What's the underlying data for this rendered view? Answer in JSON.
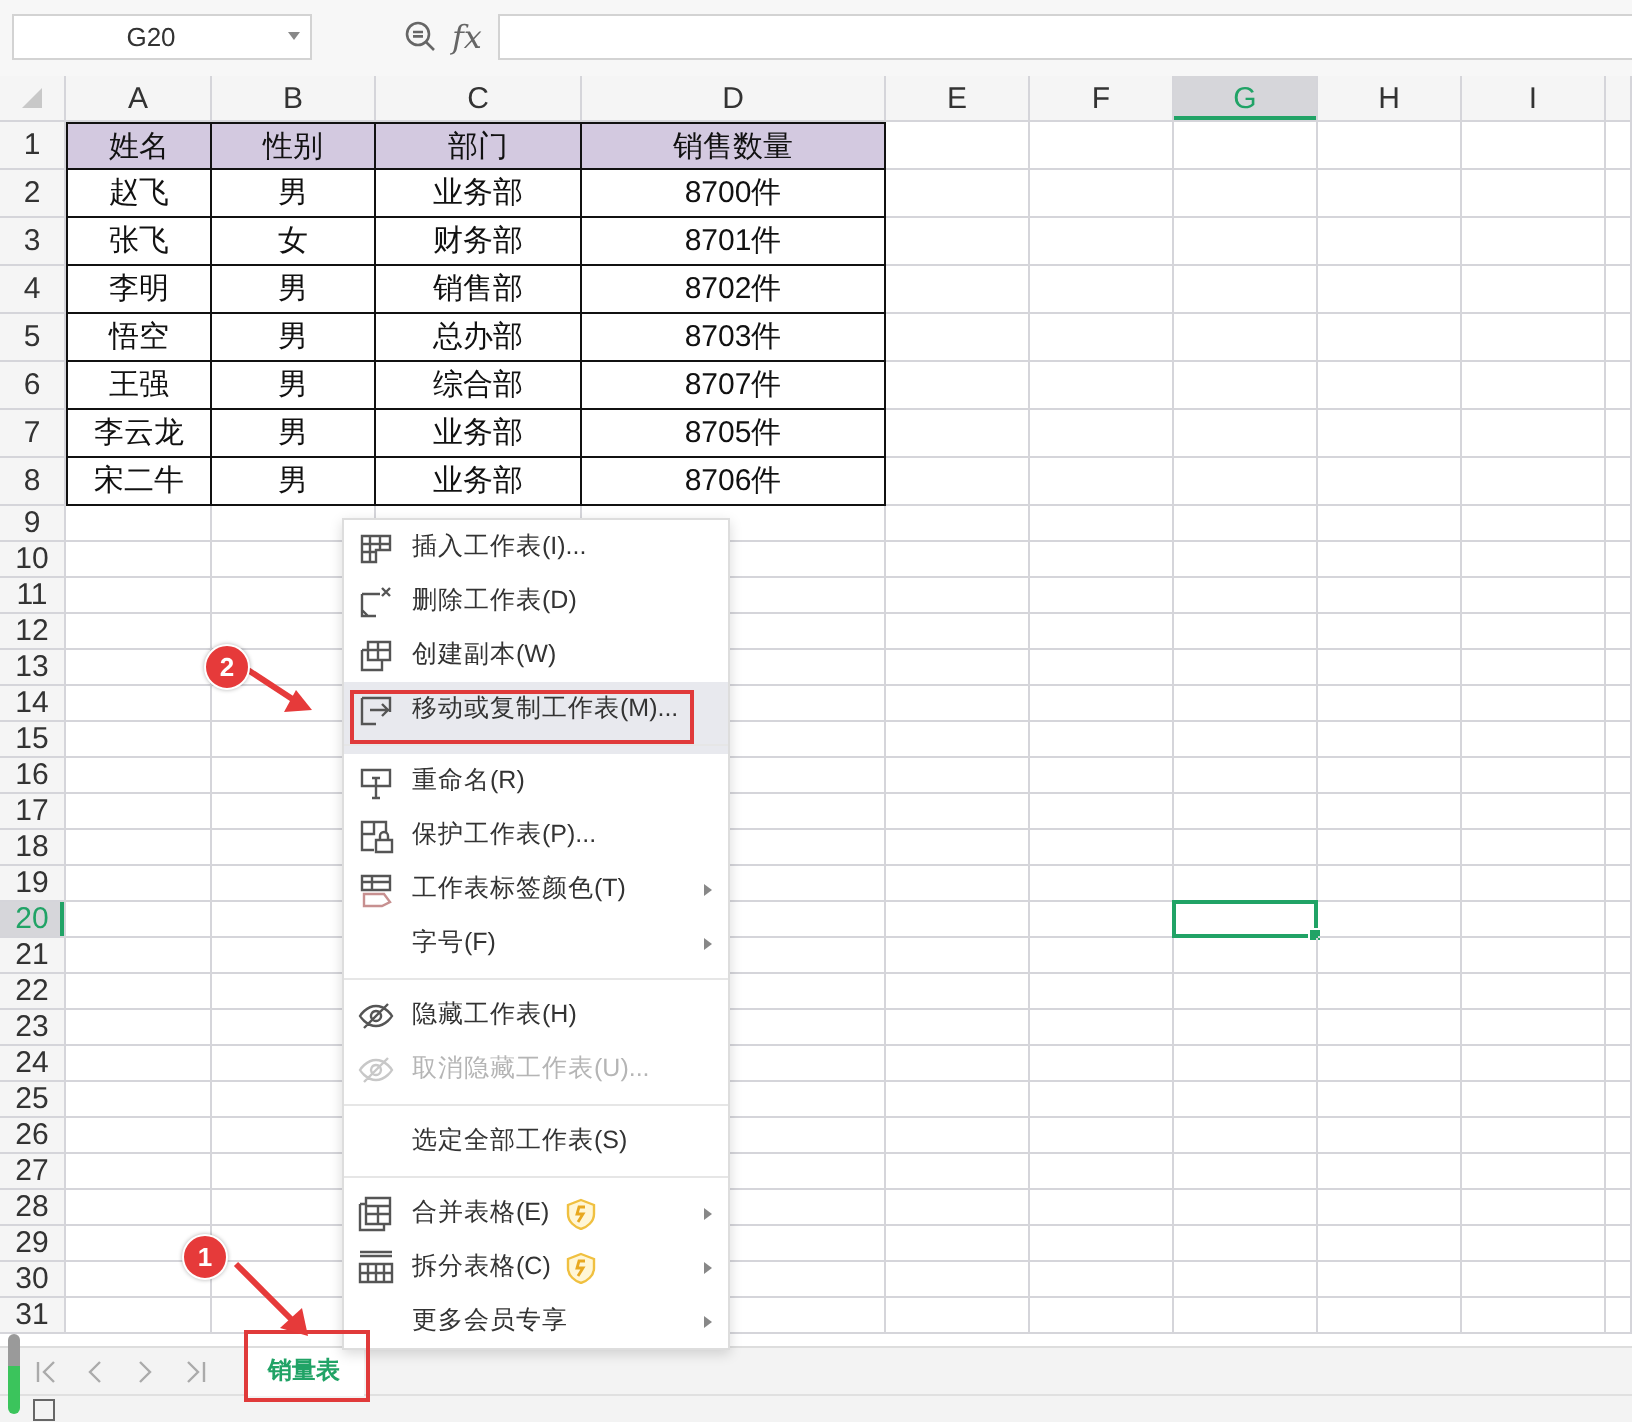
{
  "name_box": {
    "value": "G20"
  },
  "formula_bar": {
    "function_label": "fx"
  },
  "columns": [
    {
      "label": "A",
      "selected": false
    },
    {
      "label": "B",
      "selected": false
    },
    {
      "label": "C",
      "selected": false
    },
    {
      "label": "D",
      "selected": false
    },
    {
      "label": "E",
      "selected": false
    },
    {
      "label": "F",
      "selected": false
    },
    {
      "label": "G",
      "selected": true
    },
    {
      "label": "H",
      "selected": false
    },
    {
      "label": "I",
      "selected": false
    }
  ],
  "rows": [
    {
      "number": "1",
      "selected": false,
      "kind": "header",
      "cells": [
        "姓名",
        "性别",
        "部门",
        "销售数量"
      ]
    },
    {
      "number": "2",
      "selected": false,
      "kind": "data",
      "cells": [
        "赵飞",
        "男",
        "业务部",
        "8700件"
      ]
    },
    {
      "number": "3",
      "selected": false,
      "kind": "data",
      "cells": [
        "张飞",
        "女",
        "财务部",
        "8701件"
      ]
    },
    {
      "number": "4",
      "selected": false,
      "kind": "data",
      "cells": [
        "李明",
        "男",
        "销售部",
        "8702件"
      ]
    },
    {
      "number": "5",
      "selected": false,
      "kind": "data",
      "cells": [
        "悟空",
        "男",
        "总办部",
        "8703件"
      ]
    },
    {
      "number": "6",
      "selected": false,
      "kind": "data",
      "cells": [
        "王强",
        "男",
        "综合部",
        "8707件"
      ]
    },
    {
      "number": "7",
      "selected": false,
      "kind": "data",
      "cells": [
        "李云龙",
        "男",
        "业务部",
        "8705件"
      ]
    },
    {
      "number": "8",
      "selected": false,
      "kind": "data",
      "cells": [
        "宋二牛",
        "男",
        "业务部",
        "8706件"
      ]
    },
    {
      "number": "9",
      "selected": false
    },
    {
      "number": "10",
      "selected": false
    },
    {
      "number": "11",
      "selected": false
    },
    {
      "number": "12",
      "selected": false
    },
    {
      "number": "13",
      "selected": false
    },
    {
      "number": "14",
      "selected": false
    },
    {
      "number": "15",
      "selected": false
    },
    {
      "number": "16",
      "selected": false
    },
    {
      "number": "17",
      "selected": false
    },
    {
      "number": "18",
      "selected": false
    },
    {
      "number": "19",
      "selected": false
    },
    {
      "number": "20",
      "selected": true
    },
    {
      "number": "21",
      "selected": false
    },
    {
      "number": "22",
      "selected": false
    },
    {
      "number": "23",
      "selected": false
    },
    {
      "number": "24",
      "selected": false
    },
    {
      "number": "25",
      "selected": false
    },
    {
      "number": "26",
      "selected": false
    },
    {
      "number": "27",
      "selected": false
    },
    {
      "number": "28",
      "selected": false
    },
    {
      "number": "29",
      "selected": false
    },
    {
      "number": "30",
      "selected": false
    },
    {
      "number": "31",
      "selected": false
    }
  ],
  "context_menu": {
    "items": [
      {
        "label": "插入工作表(I)...",
        "selected": false,
        "disabled": false,
        "submenu": false,
        "vip": false,
        "separator_after": false
      },
      {
        "label": "删除工作表(D)",
        "selected": false,
        "disabled": false,
        "submenu": false,
        "vip": false,
        "separator_after": false
      },
      {
        "label": "创建副本(W)",
        "selected": false,
        "disabled": false,
        "submenu": false,
        "vip": false,
        "separator_after": false
      },
      {
        "label": "移动或复制工作表(M)...",
        "selected": true,
        "disabled": false,
        "submenu": false,
        "vip": false,
        "separator_after": true
      },
      {
        "label": "重命名(R)",
        "selected": false,
        "disabled": false,
        "submenu": false,
        "vip": false,
        "separator_after": false
      },
      {
        "label": "保护工作表(P)...",
        "selected": false,
        "disabled": false,
        "submenu": false,
        "vip": false,
        "separator_after": false
      },
      {
        "label": "工作表标签颜色(T)",
        "selected": false,
        "disabled": false,
        "submenu": true,
        "vip": false,
        "separator_after": false
      },
      {
        "label": "字号(F)",
        "selected": false,
        "disabled": false,
        "submenu": true,
        "vip": false,
        "separator_after": true
      },
      {
        "label": "隐藏工作表(H)",
        "selected": false,
        "disabled": false,
        "submenu": false,
        "vip": false,
        "separator_after": false
      },
      {
        "label": "取消隐藏工作表(U)...",
        "selected": false,
        "disabled": true,
        "submenu": false,
        "vip": false,
        "separator_after": true
      },
      {
        "label": "选定全部工作表(S)",
        "selected": false,
        "disabled": false,
        "submenu": false,
        "vip": false,
        "separator_after": true
      },
      {
        "label": "合并表格(E)",
        "selected": false,
        "disabled": false,
        "submenu": true,
        "vip": true,
        "separator_after": false
      },
      {
        "label": "拆分表格(C)",
        "selected": false,
        "disabled": false,
        "submenu": true,
        "vip": true,
        "separator_after": false
      },
      {
        "label": "更多会员专享",
        "selected": false,
        "disabled": false,
        "submenu": true,
        "vip": false,
        "separator_after": false
      }
    ]
  },
  "sheet_tabs": [
    {
      "label": "销量表",
      "selected": true
    }
  ],
  "annotations": [
    {
      "number": "1"
    },
    {
      "number": "2"
    }
  ]
}
